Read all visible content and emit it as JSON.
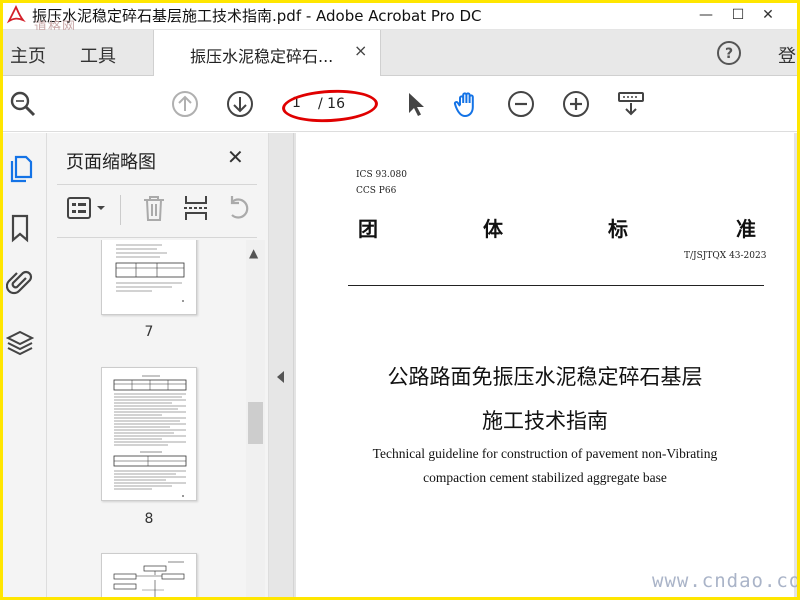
{
  "window": {
    "title": "振压水泥稳定碎石基层施工技术指南.pdf - Adobe Acrobat Pro DC",
    "watermark_top": "道格网",
    "minimize": "—",
    "maximize": "☐",
    "close": "✕"
  },
  "tabs": {
    "home_label": "主页",
    "tools_label": "工具",
    "doc_tab_label": "振压水泥稳定碎石...",
    "doc_tab_close": "×",
    "login_label": "登"
  },
  "toolbar": {
    "current_page": "1",
    "total_pages": "/ 16",
    "highlight_color": "#e00000",
    "icons": [
      "zoom-search-icon",
      "prev-page-icon",
      "next-page-icon",
      "select-cursor-icon",
      "hand-tool-icon",
      "zoom-out-icon",
      "zoom-in-icon",
      "page-display-icon"
    ]
  },
  "rail": {
    "icons": [
      "page-thumbnails-icon",
      "bookmark-icon",
      "attachment-icon",
      "layers-icon"
    ],
    "accent": "#1473e6"
  },
  "panel": {
    "title": "页面缩略图",
    "close": "✕",
    "scroll_up": "▲",
    "thumbnails": [
      {
        "label": "7"
      },
      {
        "label": "8"
      }
    ]
  },
  "document": {
    "ics": "ICS 93.080",
    "ccs": "CCS P66",
    "standard_heading": [
      "团",
      "体",
      "标",
      "准"
    ],
    "standard_code": "T/JSJTQX 43-2023",
    "title_zh_line1": "公路路面免振压水泥稳定碎石基层",
    "title_zh_line2": "施工技术指南",
    "title_en_line1": "Technical guideline for construction of pavement non-Vibrating",
    "title_en_line2": "compaction cement stabilized aggregate base"
  },
  "watermark_bottom": "www.cndao.com",
  "frame_color": "#ffe600"
}
